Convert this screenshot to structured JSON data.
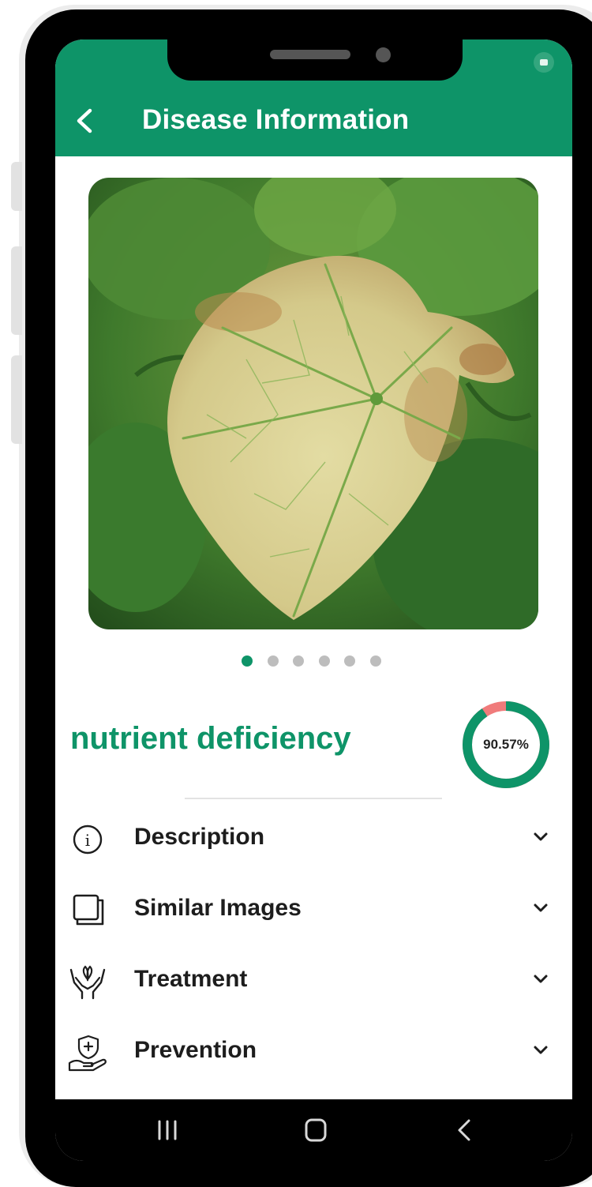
{
  "header": {
    "title": "Disease Information",
    "back_icon": "back-chevron-icon",
    "background_color": "#0e9468"
  },
  "status_bar": {
    "camera_notification_icon": "camera-icon"
  },
  "image_gallery": {
    "image_description": "Photo of a yellowing cucumber leaf with green veins and brown speckles",
    "page_count": 6,
    "active_page": 1
  },
  "result": {
    "disease_name": "nutrient deficiency",
    "confidence_label": "90.57%",
    "confidence_percent": 90.57,
    "accent_color": "#0e9468",
    "remaining_color": "#f07b7b"
  },
  "sections": [
    {
      "label": "Description",
      "icon": "info-icon"
    },
    {
      "label": "Similar Images",
      "icon": "images-stack-icon"
    },
    {
      "label": "Treatment",
      "icon": "hands-plant-icon"
    },
    {
      "label": "Prevention",
      "icon": "shield-hand-icon"
    }
  ],
  "navbar": {
    "recents_icon": "recents-icon",
    "home_icon": "home-icon",
    "back_icon": "back-icon"
  }
}
